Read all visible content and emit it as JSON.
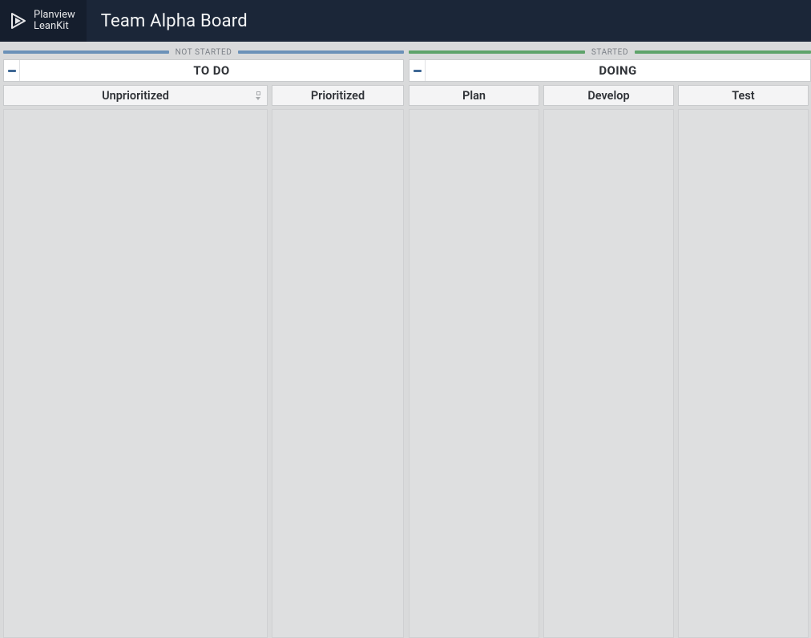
{
  "brand": {
    "line1": "Planview",
    "line2": "LeanKit"
  },
  "board": {
    "title": "Team Alpha Board"
  },
  "sections": [
    {
      "status_label": "NOT STARTED",
      "status_color": "blue",
      "lane_title": "TO DO",
      "sublanes": [
        {
          "label": "Unprioritized",
          "has_sort": true,
          "width_class": "col-unprioritized"
        },
        {
          "label": "Prioritized",
          "has_sort": false,
          "width_class": "col-prioritized"
        }
      ]
    },
    {
      "status_label": "STARTED",
      "status_color": "green",
      "lane_title": "DOING",
      "sublanes": [
        {
          "label": "Plan",
          "has_sort": false,
          "width_class": "col-plan"
        },
        {
          "label": "Develop",
          "has_sort": false,
          "width_class": "col-develop"
        },
        {
          "label": "Test",
          "has_sort": false,
          "width_class": "col-test"
        }
      ]
    }
  ]
}
